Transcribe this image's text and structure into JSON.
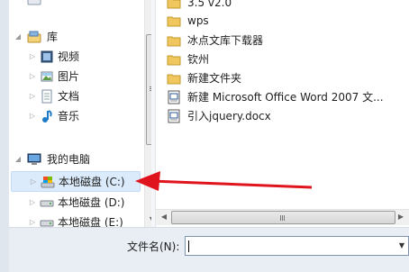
{
  "nav": {
    "top_partial_label": "",
    "library": {
      "label": "库"
    },
    "libraries": [
      {
        "label": "视频",
        "icon": "video-library-icon"
      },
      {
        "label": "图片",
        "icon": "pictures-library-icon"
      },
      {
        "label": "文档",
        "icon": "documents-library-icon"
      },
      {
        "label": "音乐",
        "icon": "music-library-icon"
      }
    ],
    "computer": {
      "label": "我的电脑"
    },
    "drives": [
      {
        "label": "本地磁盘 (C:)"
      },
      {
        "label": "本地磁盘 (D:)"
      },
      {
        "label": "本地磁盘 (E:)"
      }
    ]
  },
  "files": [
    {
      "name": "3.5  v2.0",
      "type": "folder"
    },
    {
      "name": "wps",
      "type": "folder"
    },
    {
      "name": "冰点文库下载器",
      "type": "folder"
    },
    {
      "name": "钦州",
      "type": "folder"
    },
    {
      "name": "新建文件夹",
      "type": "folder"
    },
    {
      "name": "新建 Microsoft Office Word 2007 文...",
      "type": "word"
    },
    {
      "name": "引入jquery.docx",
      "type": "word"
    }
  ],
  "bottom": {
    "filename_label": "文件名(N):",
    "filename_value": ""
  },
  "colors": {
    "annotation_arrow": "#e0141c",
    "folder": "#f0c75e",
    "selection": "#dcebfc"
  }
}
